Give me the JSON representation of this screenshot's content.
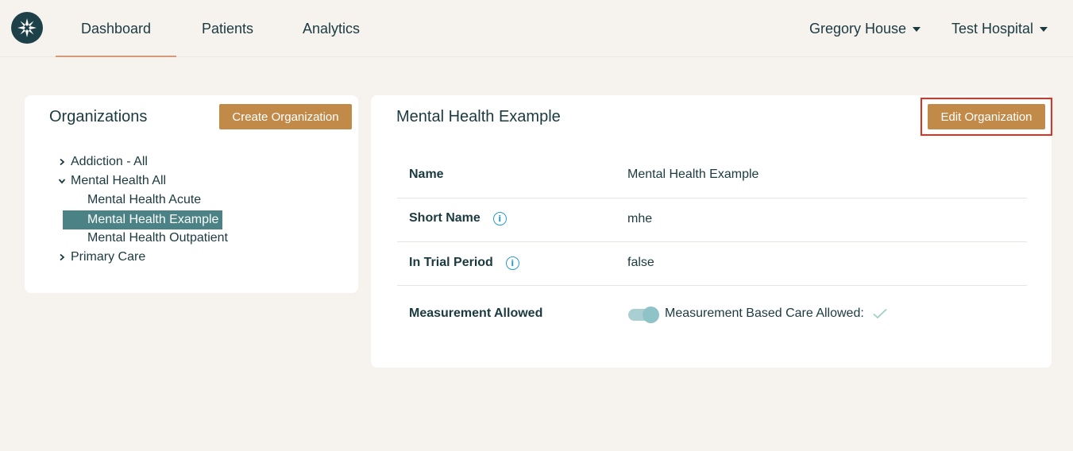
{
  "nav": {
    "items": [
      {
        "label": "Dashboard"
      },
      {
        "label": "Patients"
      },
      {
        "label": "Analytics"
      }
    ],
    "user": "Gregory House",
    "organization": "Test Hospital"
  },
  "organizations": {
    "title": "Organizations",
    "create_button": "Create Organization",
    "tree": [
      {
        "label": "Addiction - All",
        "expander": "collapsed"
      },
      {
        "label": "Mental Health All",
        "expander": "expanded"
      },
      {
        "label": "Mental Health Acute"
      },
      {
        "label": "Mental Health Example",
        "selected": true
      },
      {
        "label": "Mental Health Outpatient"
      },
      {
        "label": "Primary Care",
        "expander": "collapsed"
      }
    ]
  },
  "detail": {
    "title": "Mental Health Example",
    "edit_button": "Edit Organization",
    "rows": [
      {
        "label": "Name",
        "value": "Mental Health Example"
      },
      {
        "label": "Short Name",
        "value": "mhe",
        "info": true
      },
      {
        "label": "In Trial Period",
        "value": "false",
        "info": true
      },
      {
        "label": "Measurement Allowed",
        "value": "Measurement Based Care Allowed:",
        "toggle_on": true,
        "check": true
      }
    ]
  },
  "colors": {
    "accent_button": "#c18a48",
    "selected_row": "#4b8285",
    "primary_text": "#1b3a40",
    "highlight_border": "#e3301e",
    "info_icon": "#2a9bc9"
  }
}
